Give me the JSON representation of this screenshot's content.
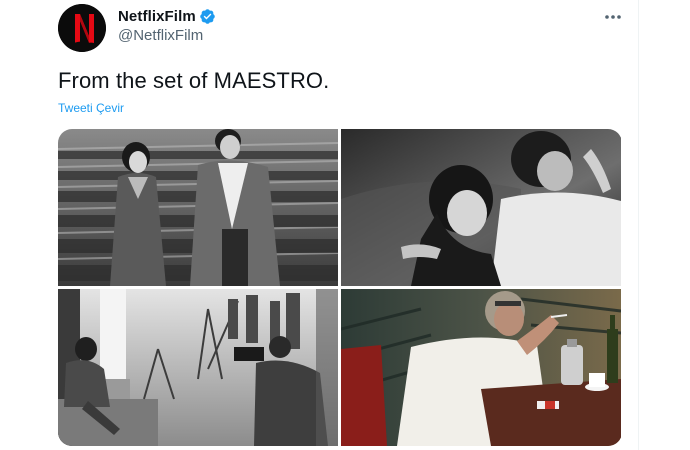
{
  "tweet": {
    "display_name": "NetflixFilm",
    "handle": "@NetflixFilm",
    "text": "From the set of MAESTRO.",
    "translate_label": "Tweeti Çevir",
    "avatar_letter": "N"
  },
  "icons": {
    "verified": "verified-badge-icon",
    "more": "more-options-icon"
  },
  "colors": {
    "brand_red": "#e50914",
    "verified_blue": "#1d9bf0",
    "link_blue": "#1d9bf0",
    "secondary_text": "#536471"
  },
  "media": {
    "count": 4,
    "photos": [
      "photo-1",
      "photo-2",
      "photo-3",
      "photo-4"
    ]
  }
}
